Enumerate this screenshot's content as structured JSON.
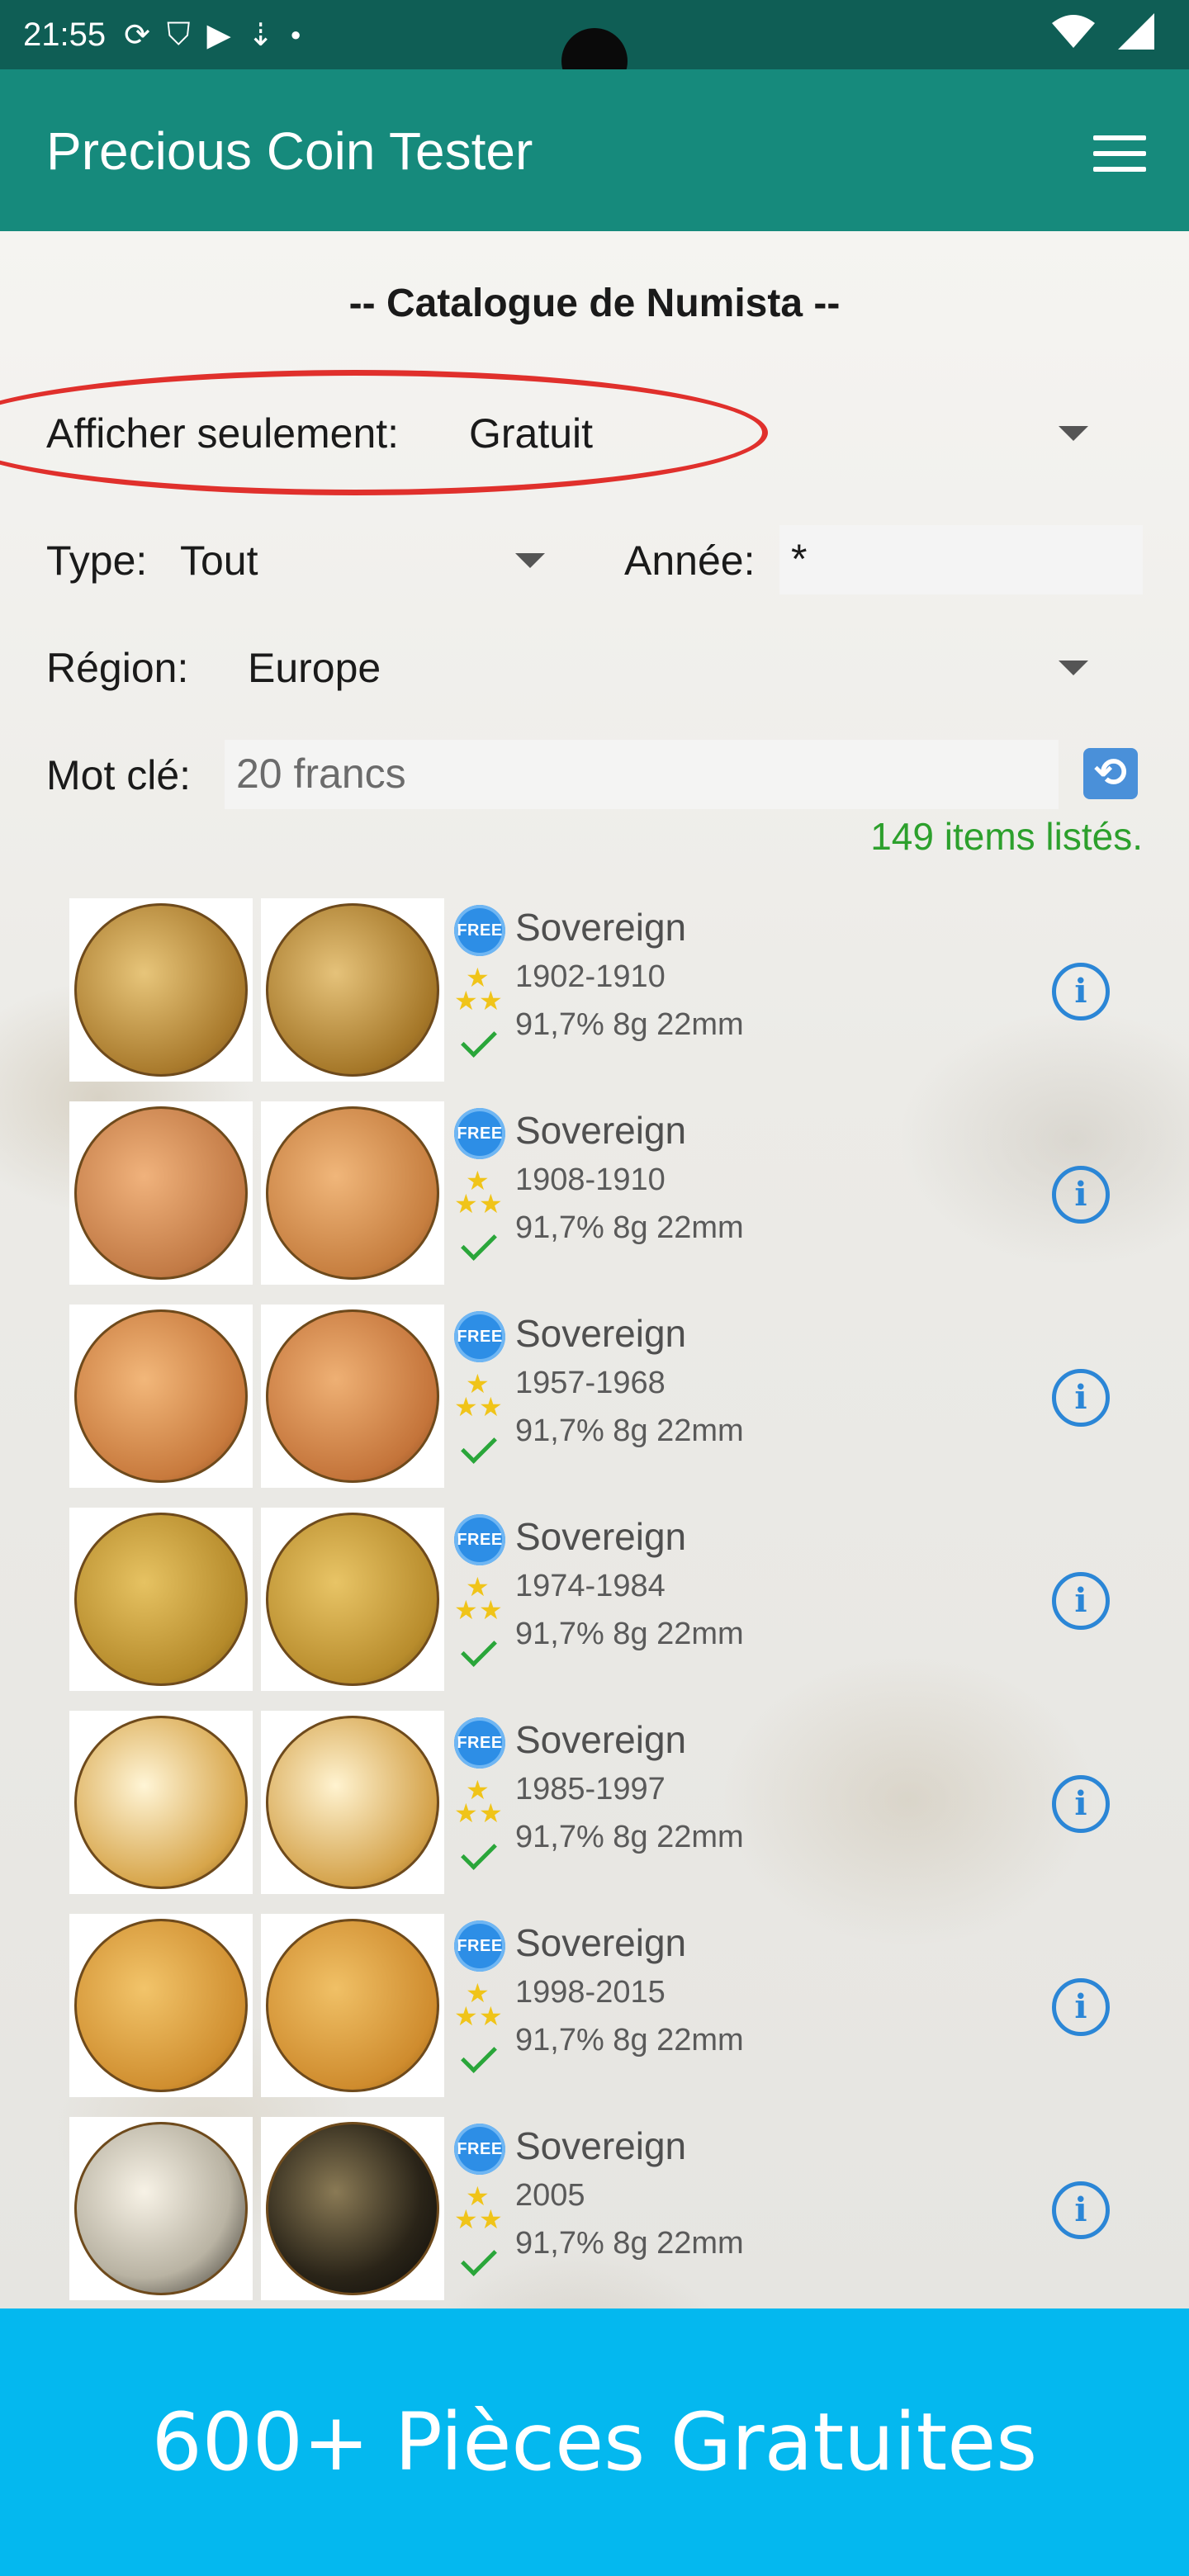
{
  "status_bar": {
    "time": "21:55",
    "icons": [
      "sync-icon",
      "shield-icon",
      "shield-play-icon",
      "download-icon",
      "dot-icon",
      "wifi-icon",
      "signal-icon"
    ]
  },
  "app_bar": {
    "title": "Precious Coin Tester",
    "menu_icon": "hamburger-menu-icon"
  },
  "catalogue": {
    "title": "-- Catalogue de Numista --"
  },
  "filters": {
    "show_only_label": "Afficher seulement:",
    "show_only_value": "Gratuit",
    "type_label": "Type:",
    "type_value": "Tout",
    "year_label": "Année:",
    "year_value": "*",
    "region_label": "Région:",
    "region_value": "Europe",
    "keyword_label": "Mot clé:",
    "keyword_value": "20 francs"
  },
  "results": {
    "count_text": "149 items listés."
  },
  "items": [
    {
      "name": "Sovereign",
      "years": "1902-1910",
      "specs": "91,7% 8g 22mm",
      "badge": "FREE"
    },
    {
      "name": "Sovereign",
      "years": "1908-1910",
      "specs": "91,7% 8g 22mm",
      "badge": "FREE"
    },
    {
      "name": "Sovereign",
      "years": "1957-1968",
      "specs": "91,7% 8g 22mm",
      "badge": "FREE"
    },
    {
      "name": "Sovereign",
      "years": "1974-1984",
      "specs": "91,7% 8g 22mm",
      "badge": "FREE"
    },
    {
      "name": "Sovereign",
      "years": "1985-1997",
      "specs": "91,7% 8g 22mm",
      "badge": "FREE"
    },
    {
      "name": "Sovereign",
      "years": "1998-2015",
      "specs": "91,7% 8g 22mm",
      "badge": "FREE"
    },
    {
      "name": "Sovereign",
      "years": "2005",
      "specs": "91,7% 8g 22mm",
      "badge": "FREE"
    }
  ],
  "banner": {
    "text": "600+ Pièces Gratuites"
  },
  "colors": {
    "status_bar": "#0f5e55",
    "app_bar": "#168a7c",
    "banner": "#04b8ef",
    "count_green": "#2ca02c",
    "annotation_red": "#e0302c",
    "info_blue": "#2b86d6"
  }
}
